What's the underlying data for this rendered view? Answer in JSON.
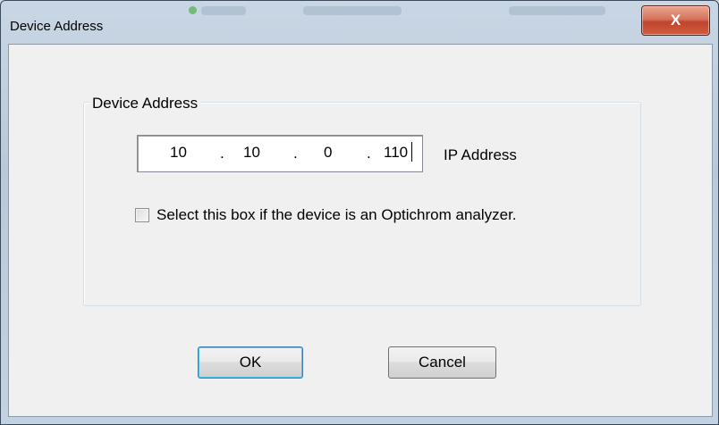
{
  "window": {
    "title": "Device Address",
    "close_label": "X"
  },
  "group": {
    "label": "Device Address"
  },
  "ip": {
    "octet1": "10",
    "octet2": "10",
    "octet3": "0",
    "octet4": "110",
    "separator": ".",
    "label": "IP Address"
  },
  "optichrom": {
    "checked": false,
    "label": "Select this box if the device is an Optichrom analyzer."
  },
  "buttons": {
    "ok_label": "OK",
    "cancel_label": "Cancel"
  },
  "colors": {
    "close_button": "#c7462e",
    "dialog_background": "#f0f0f0",
    "default_button_border": "#3c7fb1"
  }
}
